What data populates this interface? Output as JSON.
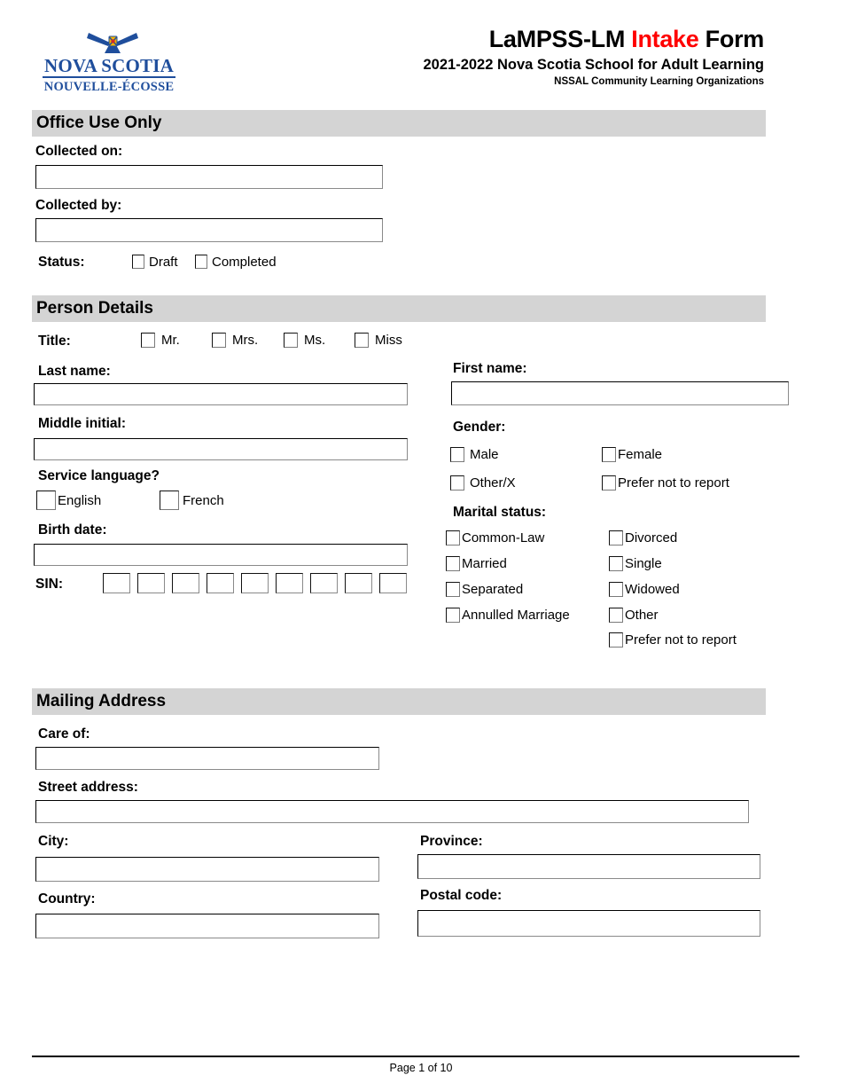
{
  "header": {
    "logo_line1": "NOVA SCOTIA",
    "logo_line2": "NOUVELLE-ÉCOSSE",
    "title_part1": "LaMPSS-LM ",
    "title_accent": "Intake",
    "title_part2": " Form",
    "subtitle": "2021-2022 Nova Scotia School for Adult Learning",
    "subtitle2": "NSSAL Community Learning Organizations",
    "accent_color": "#ff0000",
    "logo_color": "#1f4e9c"
  },
  "office_use": {
    "section_title": "Office Use Only",
    "collected_on_label": "Collected on:",
    "collected_on_value": "",
    "collected_by_label": "Collected by:",
    "collected_by_value": "",
    "status_label": "Status:",
    "status_options": [
      "Draft",
      "Completed"
    ]
  },
  "person_details": {
    "section_title": "Person Details",
    "title_label": "Title:",
    "title_options": [
      "Mr.",
      "Mrs.",
      "Ms.",
      "Miss"
    ],
    "last_name_label": "Last name:",
    "last_name_value": "",
    "first_name_label": "First name:",
    "first_name_value": "",
    "middle_initial_label": "Middle initial:",
    "middle_initial_value": "",
    "service_language_label": "Service language?",
    "service_language_options": [
      "English",
      "French"
    ],
    "gender_label": "Gender:",
    "gender_options_left": [
      "Male",
      "Other/X"
    ],
    "gender_options_right": [
      "Female",
      "Prefer not to report"
    ],
    "marital_status_label": "Marital status:",
    "marital_options_left": [
      "Common-Law",
      "Married",
      "Separated",
      "Annulled Marriage"
    ],
    "marital_options_right": [
      "Divorced",
      "Single",
      "Widowed",
      "Other",
      "Prefer not to report"
    ],
    "birth_date_label": "Birth date:",
    "birth_date_value": "",
    "sin_label": "SIN:",
    "sin_digits": [
      "",
      "",
      "",
      "",
      "",
      "",
      "",
      "",
      ""
    ]
  },
  "mailing_address": {
    "section_title": "Mailing Address",
    "care_of_label": "Care of:",
    "care_of_value": "",
    "street_label": "Street address:",
    "street_value": "",
    "city_label": "City:",
    "city_value": "",
    "province_label": "Province:",
    "province_value": "",
    "country_label": "Country:",
    "country_value": "",
    "postal_label": "Postal code:",
    "postal_value": ""
  },
  "footer": {
    "page_text": "Page 1 of 10"
  }
}
